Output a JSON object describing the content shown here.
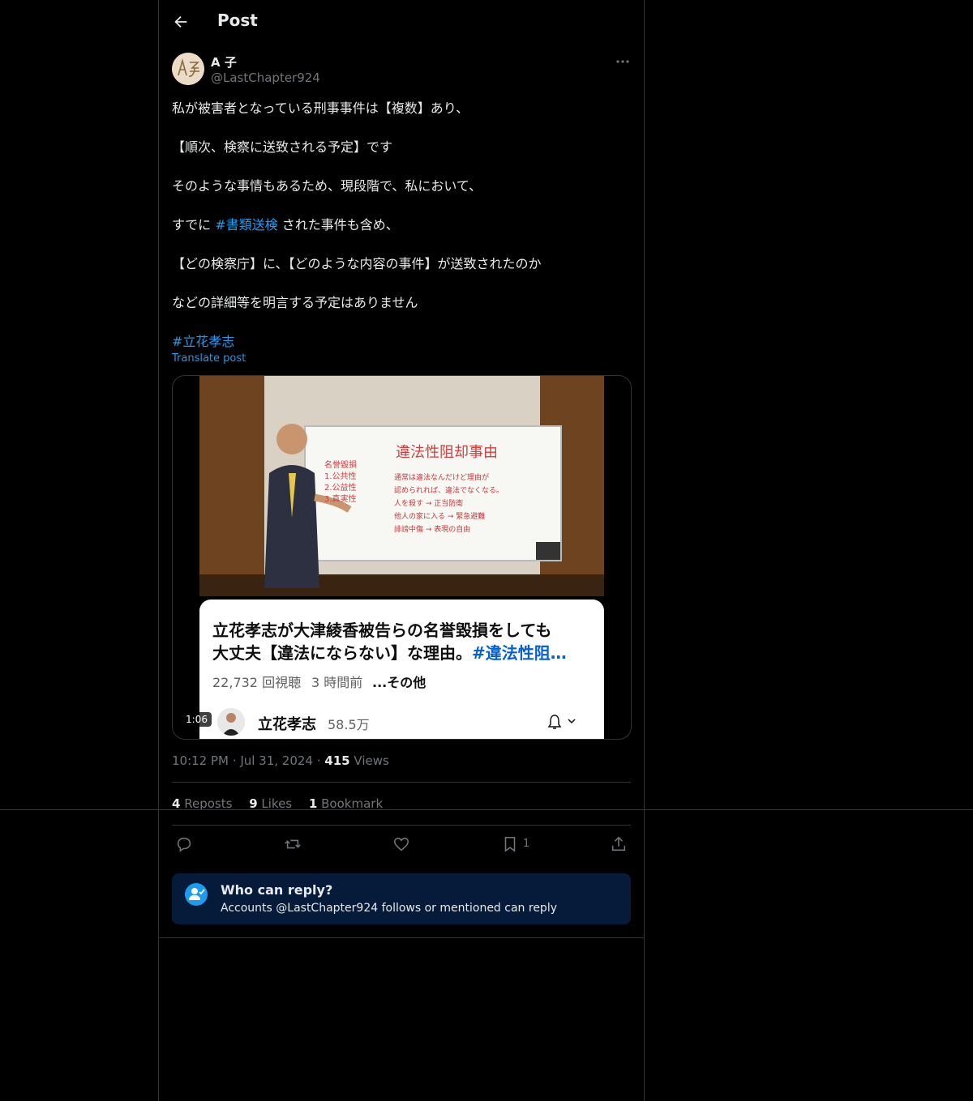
{
  "header": {
    "title": "Post"
  },
  "author": {
    "name": "A 子",
    "handle": "@LastChapter924",
    "avatar_text": "A子"
  },
  "post": {
    "line1": "私が被害者となっている刑事事件は【複数】あり、",
    "line2": "【順次、検察に送致される予定】です",
    "line3": "そのような事情もあるため、現段階で、私において、",
    "line4_pre": "すでに",
    "line4_hashtag": "#書類送検",
    "line4_post": "された事件も含め、",
    "line5": "【どの検察庁】に、【どのような内容の事件】が送致されたのか",
    "line6": "などの詳細等を明言する予定はありません",
    "hashtag": "#立花孝志",
    "translate": "Translate post"
  },
  "media": {
    "duration": "1:06",
    "yt_title_line1": "立花孝志が大津綾香被告らの名誉毀損をしても",
    "yt_title_line2": "大丈夫【違法にならない】な理由。",
    "yt_title_hash": "#違法性阻…",
    "yt_views": "22,732 回視聴",
    "yt_ago": "3 時間前",
    "yt_more": "...その他",
    "yt_channel": "立花孝志",
    "yt_subs": "58.5万",
    "whiteboard_title": "違法性阻却事由",
    "whiteboard_lines": [
      "名誉毀損",
      "1.公共性",
      "2.公益性",
      "3.真実性",
      "通常は違法なんだけど理由が",
      "認められれば、違法でなくなる。",
      "人を殺す → 正当防衛",
      "他人の家に入る → 緊急避難",
      "誹謗中傷 → 表現の自由"
    ]
  },
  "meta": {
    "time": "10:12 PM",
    "date": "Jul 31, 2024",
    "views_count": "415",
    "views_label": "Views"
  },
  "stats": {
    "reposts_count": "4",
    "reposts_label": "Reposts",
    "likes_count": "9",
    "likes_label": "Likes",
    "bookmarks_count": "1",
    "bookmarks_label": "Bookmark"
  },
  "actions": {
    "bookmark_count": "1"
  },
  "reply": {
    "title": "Who can reply?",
    "subtitle": "Accounts @LastChapter924 follows or mentioned can reply"
  },
  "colors": {
    "accent": "#1d9bf0",
    "background": "#000000",
    "reply_box": "#061a3a"
  }
}
